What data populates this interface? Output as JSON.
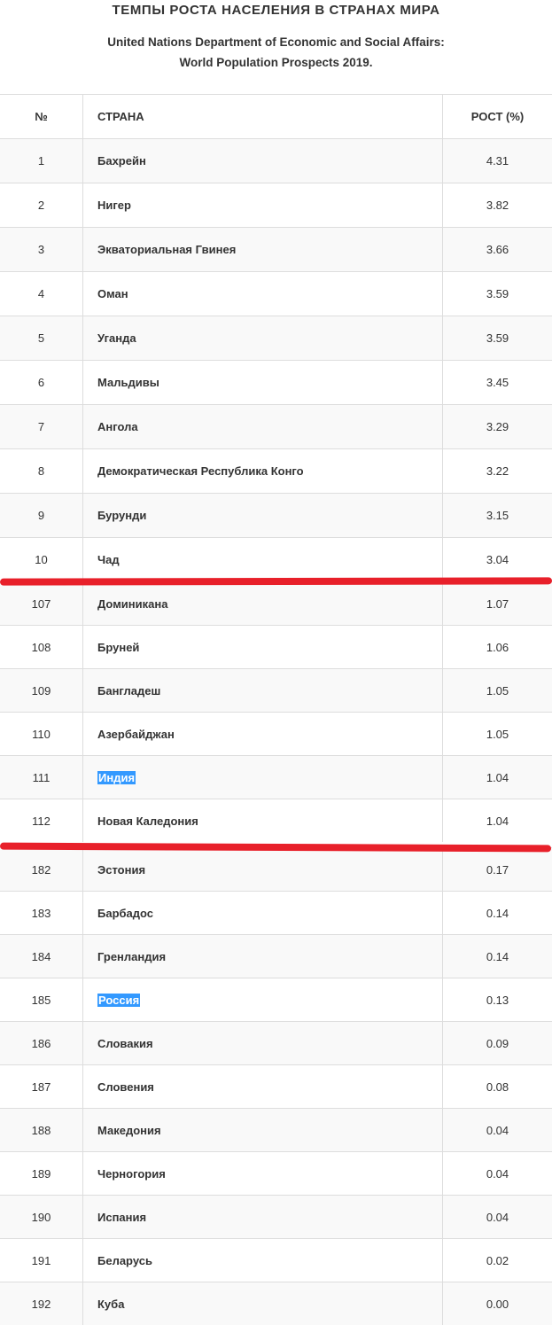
{
  "header": {
    "title": "ТЕМПЫ РОСТА НАСЕЛЕНИЯ В СТРАНАХ МИРА",
    "subtitle_line1": "United Nations Department of Economic and Social Affairs:",
    "subtitle_line2": "World Population Prospects 2019."
  },
  "table": {
    "columns": [
      "№",
      "СТРАНА",
      "РОСТ (%)"
    ],
    "rows": [
      {
        "num": "1",
        "country": "Бахрейн",
        "growth": "4.31"
      },
      {
        "num": "2",
        "country": "Нигер",
        "growth": "3.82"
      },
      {
        "num": "3",
        "country": "Экваториальная Гвинея",
        "growth": "3.66"
      },
      {
        "num": "4",
        "country": "Оман",
        "growth": "3.59"
      },
      {
        "num": "5",
        "country": "Уганда",
        "growth": "3.59"
      },
      {
        "num": "6",
        "country": "Мальдивы",
        "growth": "3.45"
      },
      {
        "num": "7",
        "country": "Ангола",
        "growth": "3.29"
      },
      {
        "num": "8",
        "country": "Демократическая Республика Конго",
        "growth": "3.22"
      },
      {
        "num": "9",
        "country": "Бурунди",
        "growth": "3.15"
      },
      {
        "num": "10",
        "country": "Чад",
        "growth": "3.04"
      },
      {
        "num": "107",
        "country": "Доминикана",
        "growth": "1.07"
      },
      {
        "num": "108",
        "country": "Бруней",
        "growth": "1.06"
      },
      {
        "num": "109",
        "country": "Бангладеш",
        "growth": "1.05"
      },
      {
        "num": "110",
        "country": "Азербайджан",
        "growth": "1.05"
      },
      {
        "num": "111",
        "country": "Индия",
        "growth": "1.04",
        "highlighted": true
      },
      {
        "num": "112",
        "country": "Новая Каледония",
        "growth": "1.04"
      },
      {
        "num": "182",
        "country": "Эстония",
        "growth": "0.17"
      },
      {
        "num": "183",
        "country": "Барбадос",
        "growth": "0.14"
      },
      {
        "num": "184",
        "country": "Гренландия",
        "growth": "0.14"
      },
      {
        "num": "185",
        "country": "Россия",
        "growth": "0.13",
        "highlighted": true
      },
      {
        "num": "186",
        "country": "Словакия",
        "growth": "0.09"
      },
      {
        "num": "187",
        "country": "Словения",
        "growth": "0.08"
      },
      {
        "num": "188",
        "country": "Македония",
        "growth": "0.04"
      },
      {
        "num": "189",
        "country": "Черногория",
        "growth": "0.04"
      },
      {
        "num": "190",
        "country": "Испания",
        "growth": "0.04"
      },
      {
        "num": "191",
        "country": "Беларусь",
        "growth": "0.02"
      },
      {
        "num": "192",
        "country": "Куба",
        "growth": "0.00"
      }
    ]
  },
  "colors": {
    "separator": "#e8202a",
    "highlight": "#3399ff",
    "border": "#dddddd",
    "stripe": "#f9f9f9"
  }
}
